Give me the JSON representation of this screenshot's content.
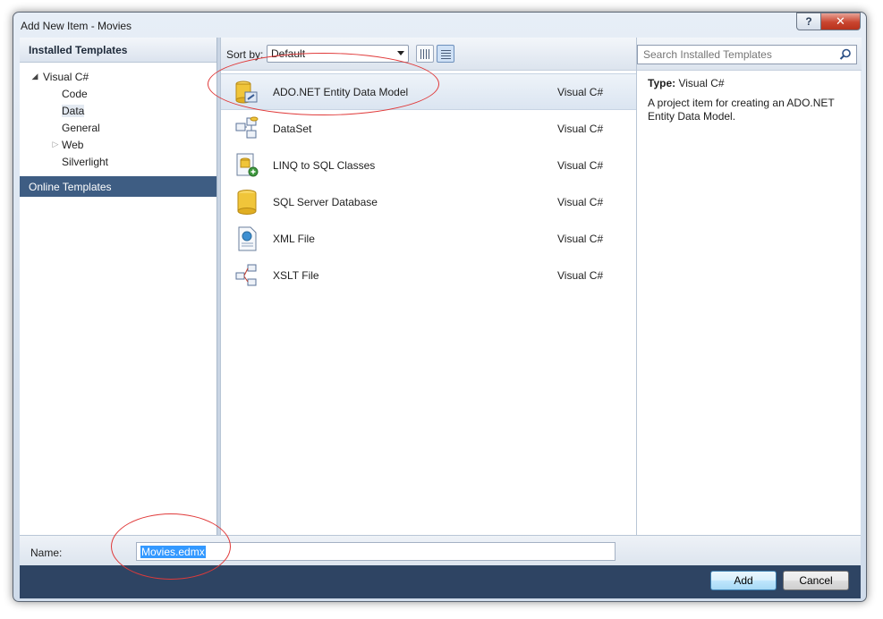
{
  "window": {
    "title": "Add New Item - Movies",
    "help_glyph": "?",
    "close_glyph": "✕"
  },
  "left": {
    "installed_header": "Installed Templates",
    "tree": [
      {
        "label": "Visual C#",
        "level": 0,
        "expanded": true
      },
      {
        "label": "Code",
        "level": 1
      },
      {
        "label": "Data",
        "level": 1,
        "selected": true
      },
      {
        "label": "General",
        "level": 1
      },
      {
        "label": "Web",
        "level": 1,
        "collapsed": true
      },
      {
        "label": "Silverlight",
        "level": 1
      }
    ],
    "online_header": "Online Templates"
  },
  "toolbar": {
    "sort_label": "Sort by:",
    "sort_value": "Default",
    "view_icons": [
      "grid-view-icon",
      "list-view-icon"
    ]
  },
  "templates": [
    {
      "name": "ADO.NET Entity Data Model",
      "lang": "Visual C#",
      "icon": "entity-data-model-icon",
      "selected": true
    },
    {
      "name": "DataSet",
      "lang": "Visual C#",
      "icon": "dataset-icon"
    },
    {
      "name": "LINQ to SQL Classes",
      "lang": "Visual C#",
      "icon": "linq-to-sql-icon"
    },
    {
      "name": "SQL Server Database",
      "lang": "Visual C#",
      "icon": "sql-database-icon"
    },
    {
      "name": "XML File",
      "lang": "Visual C#",
      "icon": "xml-file-icon"
    },
    {
      "name": "XSLT File",
      "lang": "Visual C#",
      "icon": "xslt-file-icon"
    }
  ],
  "search": {
    "placeholder": "Search Installed Templates"
  },
  "details": {
    "type_label": "Type:",
    "type_value": "Visual C#",
    "description": "A project item for creating an ADO.NET Entity Data Model."
  },
  "name_field": {
    "label": "Name:",
    "value": "Movies.edmx"
  },
  "buttons": {
    "add": "Add",
    "cancel": "Cancel"
  },
  "colors": {
    "annotation_red": "#e03a3a",
    "online_header_bg": "#3e5d83",
    "selection_highlight": "#3399ff"
  }
}
